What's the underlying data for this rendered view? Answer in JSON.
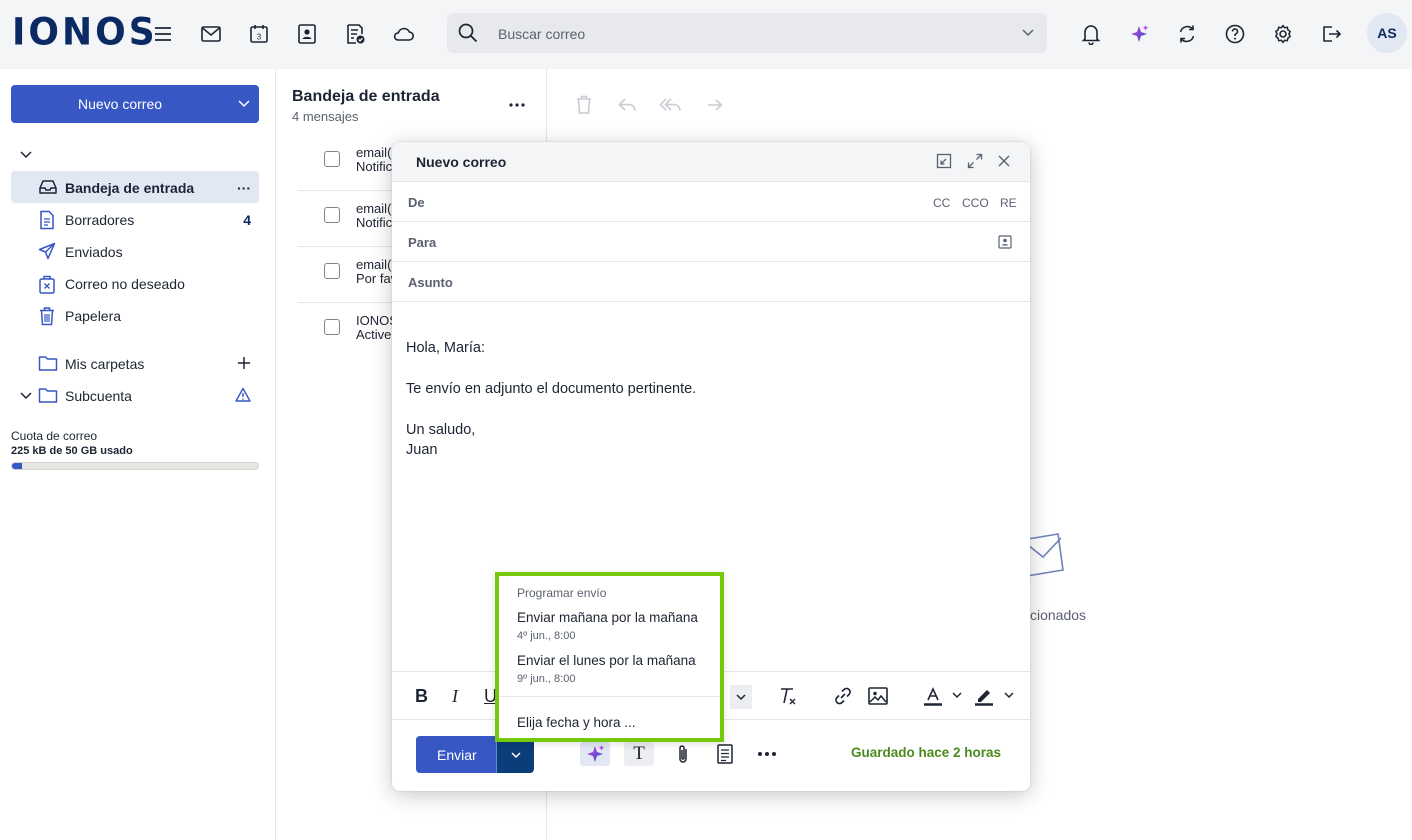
{
  "brand": {
    "logo": "IONOS",
    "accent": "#3657c4",
    "highlight": "#74c90a"
  },
  "topbar": {
    "icons": [
      "menu-icon",
      "mail-icon",
      "calendar-icon",
      "contacts-icon",
      "tasks-icon",
      "cloud-icon"
    ],
    "calendar_day": "3",
    "search_placeholder": "Buscar correo",
    "right_icons": [
      "bell-icon",
      "ai-sparkle-icon",
      "sync-icon",
      "help-icon",
      "settings-icon",
      "logout-icon"
    ],
    "avatar": "AS"
  },
  "sidebar": {
    "new_mail": "Nuevo correo",
    "folders": [
      {
        "label": "Bandeja de entrada",
        "icon": "inbox-icon",
        "active": true,
        "more": "···"
      },
      {
        "label": "Borradores",
        "icon": "drafts-icon",
        "count": "4"
      },
      {
        "label": "Enviados",
        "icon": "sent-icon"
      },
      {
        "label": "Correo no deseado",
        "icon": "spam-icon"
      },
      {
        "label": "Papelera",
        "icon": "trash-icon"
      }
    ],
    "my_folders": "Mis carpetas",
    "subaccount": "Subcuenta",
    "quota_label": "Cuota de correo",
    "quota_value": "225 kB de 50 GB usado",
    "quota_fraction": 0.04
  },
  "list": {
    "title": "Bandeja de entrada",
    "subtitle": "4 mensajes",
    "messages": [
      {
        "line1": "email(",
        "line2": "Notific"
      },
      {
        "line1": "email(",
        "line2": "Notific"
      },
      {
        "line1": "email(",
        "line2": "Por fav"
      },
      {
        "line1": "IONOS",
        "line2": "Active"
      }
    ]
  },
  "reader": {
    "empty_text": "cionados"
  },
  "compose": {
    "title": "Nuevo correo",
    "from_label": "De",
    "cc": "CC",
    "bcc": "CCO",
    "reply_to": "RE",
    "to_label": "Para",
    "subject_label": "Asunto",
    "body": [
      "Hola, María:",
      "Te envío en adjunto el documento pertinente.",
      "Un saludo,",
      "Juan"
    ],
    "format": {
      "bold": "B",
      "italic": "I",
      "underline": "U",
      "text_size": "T"
    },
    "send": "Enviar",
    "saved": "Guardado hace 2 horas"
  },
  "schedule": {
    "heading": "Programar envío",
    "options": [
      {
        "label": "Enviar mañana por la mañana",
        "when": "4º jun., 8:00"
      },
      {
        "label": "Enviar el lunes por la mañana",
        "when": "9º jun., 8:00"
      }
    ],
    "custom": "Elija fecha y hora ..."
  }
}
